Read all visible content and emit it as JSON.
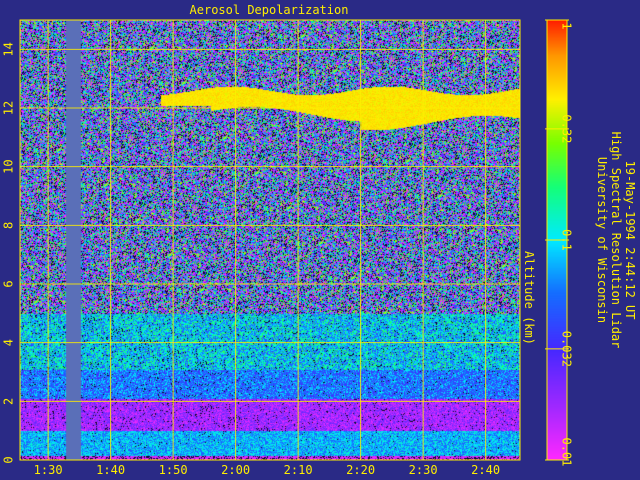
{
  "chart_data": {
    "type": "heatmap",
    "title": "Aerosol Depolarization",
    "ylabel": "Altitude (km)",
    "xlabel": "",
    "x_ticks": [
      "1:30",
      "1:40",
      "1:50",
      "2:00",
      "2:10",
      "2:20",
      "2:30",
      "2:40"
    ],
    "x_tick_minutes": [
      90,
      100,
      110,
      120,
      130,
      140,
      150,
      160
    ],
    "xlim_minutes": [
      85.5,
      165.5
    ],
    "y_ticks": [
      0,
      2,
      4,
      6,
      8,
      10,
      12,
      14
    ],
    "ylim": [
      0,
      15
    ],
    "data_gap_minutes": [
      92.7,
      95.2
    ],
    "cloud_layer_km": [
      11.8,
      12.6
    ],
    "colorbar": {
      "scale": "log",
      "range": [
        0.01,
        1
      ],
      "ticks": [
        "0.01",
        "0.032",
        "0.1",
        "0.32",
        "1"
      ],
      "tick_values": [
        0.01,
        0.032,
        0.1,
        0.32,
        1
      ]
    },
    "grid": true,
    "colors": {
      "background": "#2a2a86",
      "text": "#ffee00",
      "gap": "#5a6fb8"
    }
  },
  "side_text": {
    "line1": "University of Wisconsin",
    "line2": "High Spectral Resolution Lidar",
    "line3": "19-May-1994  2:44:12 UT"
  }
}
